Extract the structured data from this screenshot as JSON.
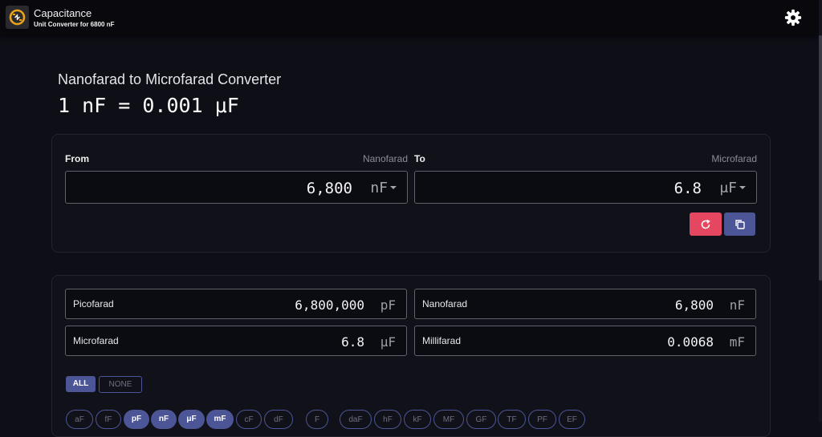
{
  "app": {
    "title": "Capacitance",
    "subtitle": "Unit Converter for 6800 nF"
  },
  "page": {
    "title": "Nanofarad to Microfarad Converter",
    "formula": "1 nF = 0.001 μF"
  },
  "converter": {
    "from": {
      "label": "From",
      "unit_name": "Nanofarad",
      "value": "6,800",
      "unit": "nF"
    },
    "to": {
      "label": "To",
      "unit_name": "Microfarad",
      "value": "6.8",
      "unit": "μF"
    },
    "icons": {
      "reset": "refresh-icon",
      "copy": "copy-icon",
      "settings": "gear-icon"
    }
  },
  "results": [
    {
      "name": "Picofarad",
      "value": "6,800,000",
      "unit": "pF"
    },
    {
      "name": "Nanofarad",
      "value": "6,800",
      "unit": "nF"
    },
    {
      "name": "Microfarad",
      "value": "6.8",
      "unit": "μF"
    },
    {
      "name": "Millifarad",
      "value": "0.0068",
      "unit": "mF"
    }
  ],
  "filters": {
    "all_label": "ALL",
    "none_label": "NONE",
    "chips": [
      {
        "label": "aF",
        "selected": false
      },
      {
        "label": "fF",
        "selected": false
      },
      {
        "label": "pF",
        "selected": true
      },
      {
        "label": "nF",
        "selected": true
      },
      {
        "label": "μF",
        "selected": true
      },
      {
        "label": "mF",
        "selected": true
      },
      {
        "label": "cF",
        "selected": false
      },
      {
        "label": "dF",
        "selected": false
      },
      {
        "label": "F",
        "selected": false
      },
      {
        "label": "daF",
        "selected": false
      },
      {
        "label": "hF",
        "selected": false
      },
      {
        "label": "kF",
        "selected": false
      },
      {
        "label": "MF",
        "selected": false
      },
      {
        "label": "GF",
        "selected": false
      },
      {
        "label": "TF",
        "selected": false
      },
      {
        "label": "PF",
        "selected": false
      },
      {
        "label": "EF",
        "selected": false
      }
    ]
  },
  "colors": {
    "accent": "#4c5595",
    "reset": "#e54660",
    "background": "#0d0e16",
    "card": "#111219",
    "logo_ring": "#e8a21c"
  }
}
